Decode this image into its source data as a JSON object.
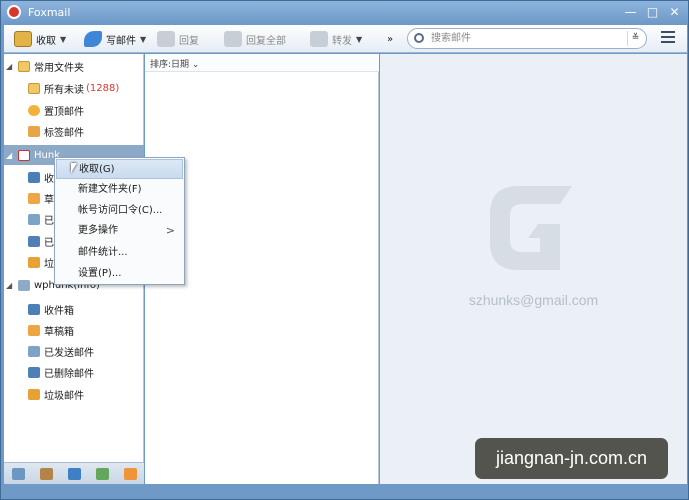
{
  "window": {
    "title": "Foxmail"
  },
  "toolbar": {
    "receive": "收取",
    "compose": "写邮件",
    "reply": "回复",
    "reply_all": "回复全部",
    "forward": "转发",
    "more": "»"
  },
  "search": {
    "placeholder": "搜索邮件"
  },
  "sidebar": {
    "favorites": "常用文件夹",
    "all_unread": "所有未读",
    "unread_count": "(1288)",
    "pinned": "置顶邮件",
    "tagged": "标签邮件",
    "account1": "Hunk",
    "account2": "wphunk(info)",
    "account1_items": [
      "收",
      "草",
      "已",
      "已",
      "垃"
    ],
    "account2_items": [
      "收件箱",
      "草稿箱",
      "已发送邮件",
      "已删除邮件",
      "垃圾邮件"
    ]
  },
  "list": {
    "sort_label": "排序:日期"
  },
  "preview": {
    "email": "szhunks@gmail.com"
  },
  "context_menu": {
    "items": [
      "收取(G)",
      "新建文件夹(F)",
      "帐号访问口令(C)...",
      "更多操作",
      "邮件统计...",
      "设置(P)..."
    ],
    "submenu_arrow": ">"
  },
  "watermark": "jiangnan-jn.com.cn",
  "icons": {
    "app": "foxmail-logo-icon",
    "receive": "inbox-tray-icon",
    "compose": "feather-pen-icon",
    "reply": "reply-arrow-icon",
    "reply_all": "reply-all-arrow-icon",
    "forward": "forward-arrow-icon",
    "menu": "hamburger-menu-icon"
  },
  "colors": {
    "accent": "#8ca9c7",
    "unread": "#d53a2f"
  }
}
